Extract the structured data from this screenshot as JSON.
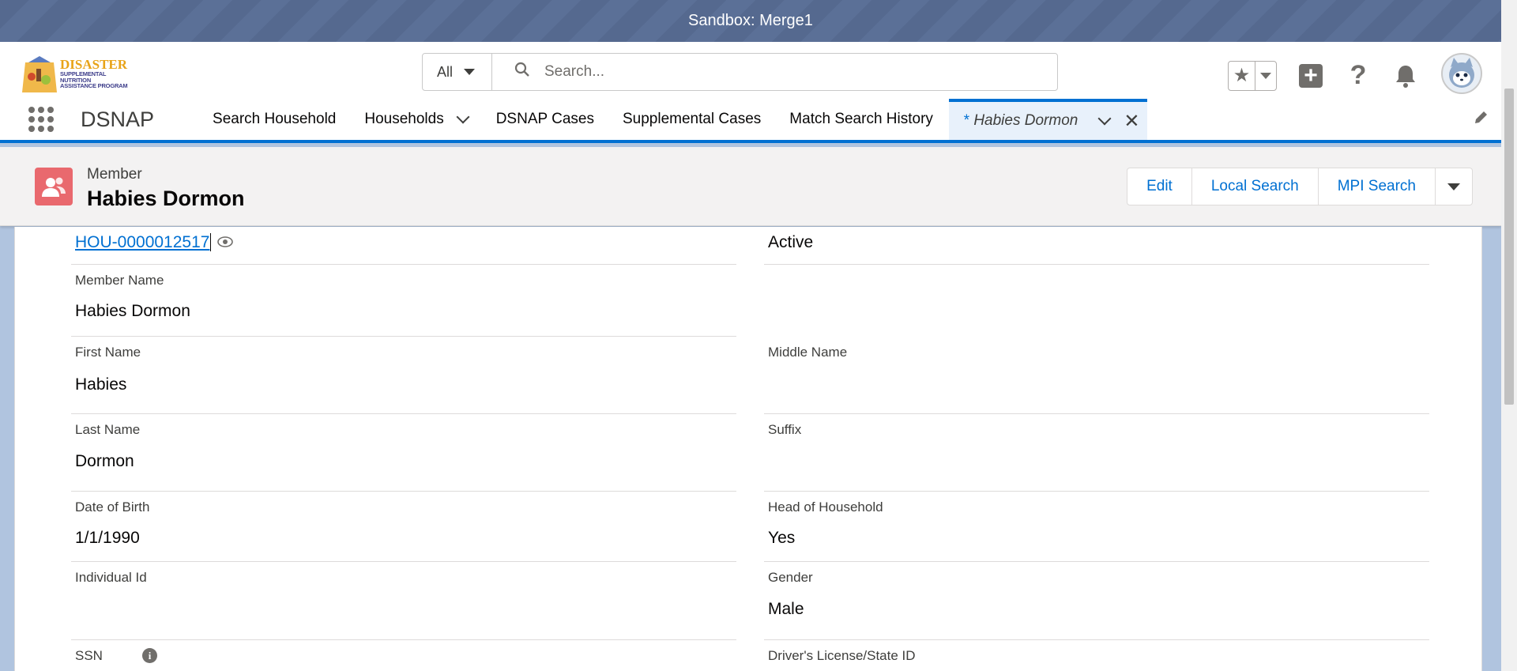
{
  "sandbox": {
    "label": "Sandbox: Merge1"
  },
  "logo": {
    "title": "DISASTER",
    "line1": "SUPPLEMENTAL NUTRITION",
    "line2": "ASSISTANCE PROGRAM"
  },
  "search": {
    "scope": "All",
    "placeholder": "Search..."
  },
  "header_icons": [
    "star-icon",
    "chevron-down-icon",
    "plus-icon",
    "help-icon",
    "bell-icon",
    "avatar"
  ],
  "nav": {
    "app_name": "DSNAP",
    "items": [
      {
        "label": "Search Household"
      },
      {
        "label": "Households"
      },
      {
        "label": "DSNAP Cases"
      },
      {
        "label": "Supplemental Cases"
      },
      {
        "label": "Match Search History"
      }
    ],
    "active_tab": {
      "prefix": "*",
      "label": "Habies Dormon"
    }
  },
  "record": {
    "type": "Member",
    "name": "Habies Dormon",
    "actions": {
      "edit": "Edit",
      "local_search": "Local Search",
      "mpi_search": "MPI Search"
    }
  },
  "fields": {
    "household_link": "HOU-0000012517",
    "status_value": "Active",
    "member_name": {
      "label": "Member Name",
      "value": "Habies Dormon"
    },
    "first_name": {
      "label": "First Name",
      "value": "Habies"
    },
    "middle_name": {
      "label": "Middle Name",
      "value": ""
    },
    "last_name": {
      "label": "Last Name",
      "value": "Dormon"
    },
    "suffix": {
      "label": "Suffix",
      "value": ""
    },
    "dob": {
      "label": "Date of Birth",
      "value": "1/1/1990"
    },
    "head_of_household": {
      "label": "Head of Household",
      "value": "Yes"
    },
    "individual_id": {
      "label": "Individual Id",
      "value": ""
    },
    "gender": {
      "label": "Gender",
      "value": "Male"
    },
    "ssn": {
      "label": "SSN"
    },
    "drivers_license": {
      "label": "Driver's License/State ID"
    }
  },
  "colors": {
    "brand": "#0070d2",
    "record_icon": "#e9696e",
    "sandbox_bar": "#55698f"
  }
}
